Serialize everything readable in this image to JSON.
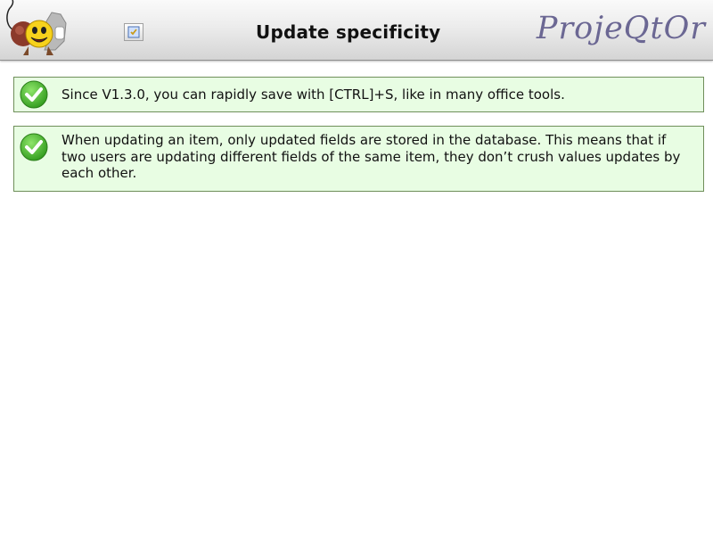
{
  "header": {
    "title": "Update specificity",
    "brand": "ProjeQtOr",
    "logo_icon": "smiley-mascot-logo-icon",
    "small_icon": "help-page-icon"
  },
  "notes": [
    {
      "icon": "checkmark-icon",
      "text": "Since V1.3.0, you can rapidly save with [CTRL]+S, like in many office tools."
    },
    {
      "icon": "checkmark-icon",
      "text": "When updating an item, only updated fields are stored in the database. This means that if two users are updating different fields of the same item, they don’t crush values updates by each other."
    }
  ],
  "colors": {
    "note_background": "#e8fde3",
    "note_border": "#6f8f5a",
    "check_green": "#4caf30",
    "brand_color": "#6b6793"
  }
}
